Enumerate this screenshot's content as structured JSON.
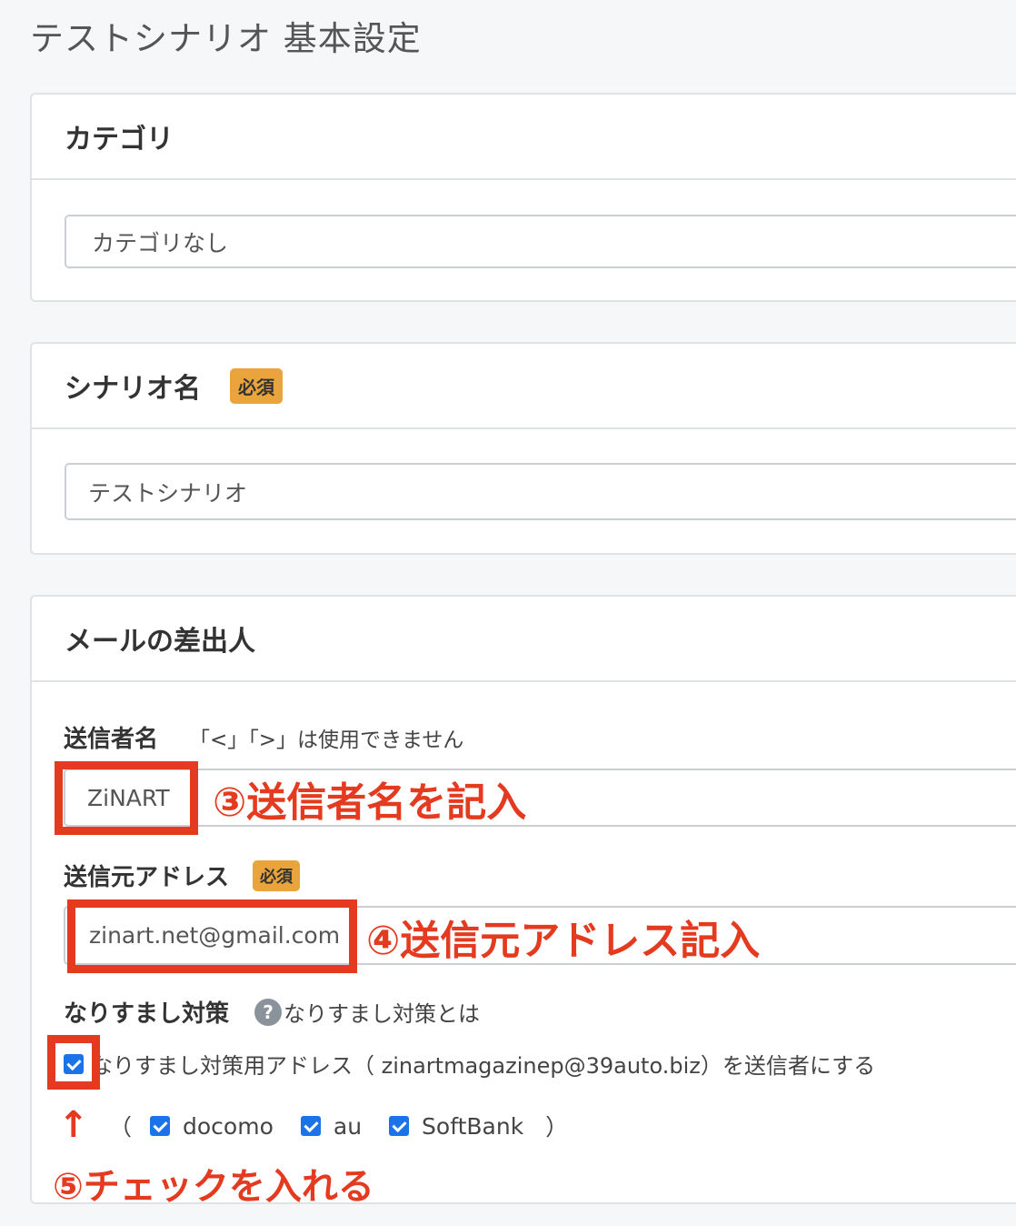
{
  "page": {
    "title": "テストシナリオ 基本設定"
  },
  "category": {
    "title": "カテゴリ",
    "value": "カテゴリなし"
  },
  "scenario_name": {
    "title": "シナリオ名",
    "badge": "必須",
    "value": "テストシナリオ"
  },
  "sender": {
    "title": "メールの差出人",
    "name_label": "送信者名",
    "name_hint": "「<」「>」は使用できません",
    "name_value": "ZiNART",
    "address_label": "送信元アドレス",
    "address_badge": "必須",
    "address_value": "zinart.net@gmail.com",
    "spoof_label": "なりすまし対策",
    "spoof_help_icon": "question-circle-icon",
    "spoof_help_link": "なりすまし対策とは",
    "spoof_checkbox_label": "なりすまし対策用アドレス（ zinartmagazinep@39auto.biz）を送信者にする",
    "spoof_checked": true,
    "carriers_open": "（",
    "carriers_close": "）",
    "carriers": [
      {
        "label": "docomo",
        "checked": true
      },
      {
        "label": "au",
        "checked": true
      },
      {
        "label": "SoftBank",
        "checked": true
      }
    ]
  },
  "annotations": {
    "step3": "③送信者名を記入",
    "step4": "④送信元アドレス記入",
    "step5": "⑤チェックを入れる",
    "arrow": "↑"
  },
  "colors": {
    "accent_red": "#e43a1f",
    "badge_orange": "#e9a53c",
    "checkbox_blue": "#1a73e8"
  }
}
